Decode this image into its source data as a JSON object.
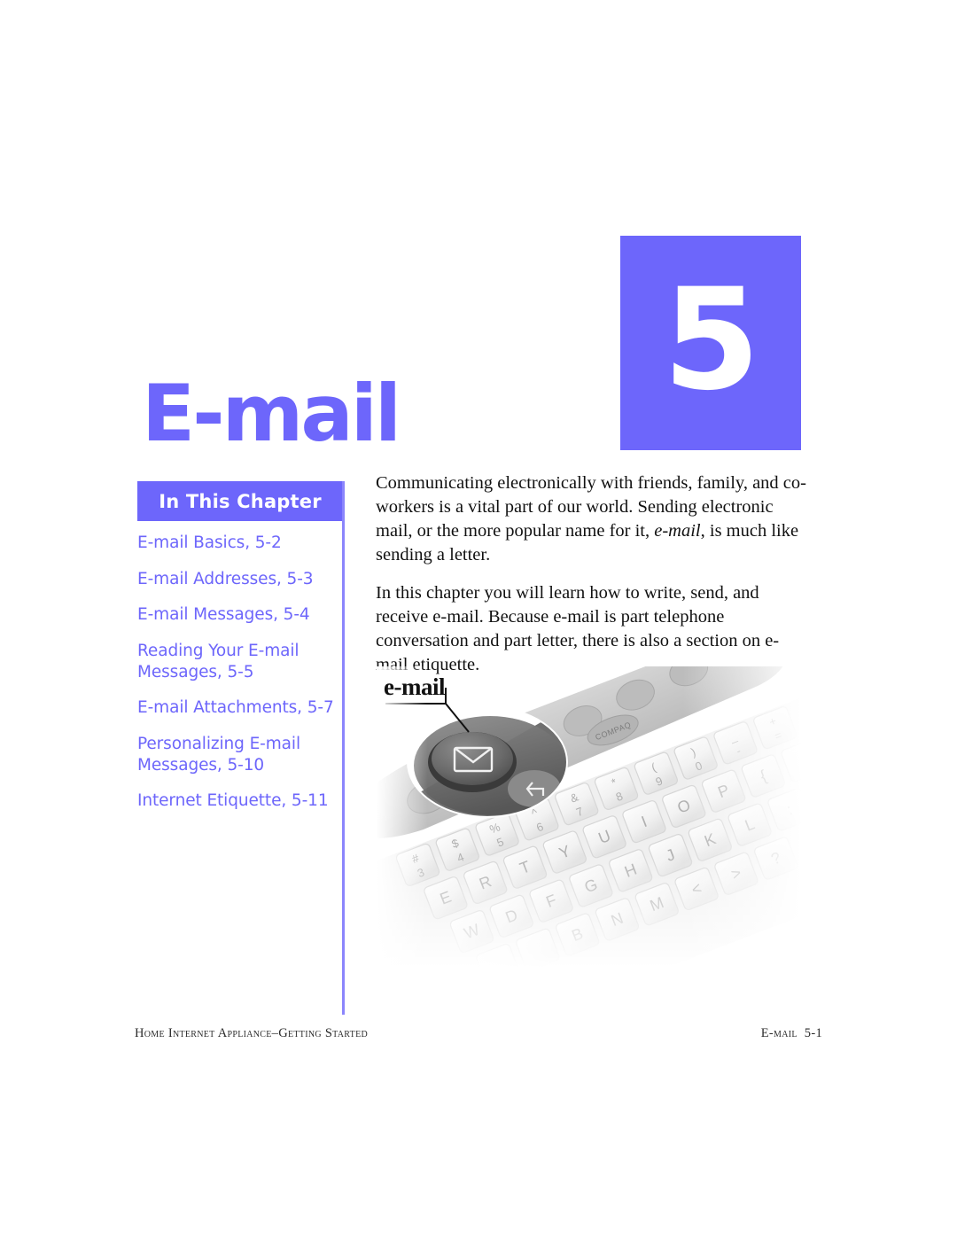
{
  "page": {
    "chapter_number": "5",
    "chapter_title": "E-mail",
    "accent_color": "#6d66fb",
    "background_color": "#ffffff"
  },
  "sidebar": {
    "header_label": "In This Chapter",
    "items": [
      {
        "label": "E-mail Basics, 5-2"
      },
      {
        "label": "E-mail Addresses, 5-3"
      },
      {
        "label": "E-mail Messages, 5-4"
      },
      {
        "label": "Reading Your E-mail Messages, 5-5"
      },
      {
        "label": "E-mail Attachments, 5-7"
      },
      {
        "label": "Personalizing E-mail Messages, 5-10"
      },
      {
        "label": "Internet Etiquette, 5-11"
      }
    ]
  },
  "body": {
    "paragraph_1_part_1": "Communicating electronically with friends, family, and co-workers is a vital part of our world. Sending electronic mail, or the more popular name for it, ",
    "paragraph_1_italic": "e-mail",
    "paragraph_1_part_2": ", is much like sending a letter.",
    "paragraph_2": "In this chapter you will learn how to write, send, and receive e-mail. Because e-mail is part telephone conversation and part letter, there is also a section on e-mail etiquette."
  },
  "figure": {
    "callout_label": "e-mail",
    "description": "Photograph of a Compaq internet keyboard showing the e-mail hotkey button with an envelope icon",
    "keycap_rows": [
      [
        "#",
        "$",
        "%",
        "^",
        "&",
        "*",
        "(",
        ")",
        "_",
        "+"
      ],
      [
        "3",
        "4",
        "5",
        "6",
        "7",
        "8",
        "9",
        "0",
        "-",
        "="
      ],
      [
        "E",
        "R",
        "T",
        "Y",
        "U",
        "I",
        "O",
        "P",
        "{"
      ],
      [
        "W",
        "D",
        "F",
        "G",
        "H",
        "J",
        "K",
        "L",
        ":"
      ],
      [
        "B",
        "N",
        "M",
        "<",
        ">",
        "?"
      ]
    ],
    "hotkey_brand": "COMPAQ",
    "hotkey_icons": [
      "envelope-icon",
      "reply-arrow-icon",
      "home-icon",
      "search-icon",
      "people-icon",
      "dollar-icon"
    ]
  },
  "footer": {
    "left": "Home Internet Appliance–Getting Started",
    "right_label": "E-mail",
    "right_page": "5-1"
  }
}
